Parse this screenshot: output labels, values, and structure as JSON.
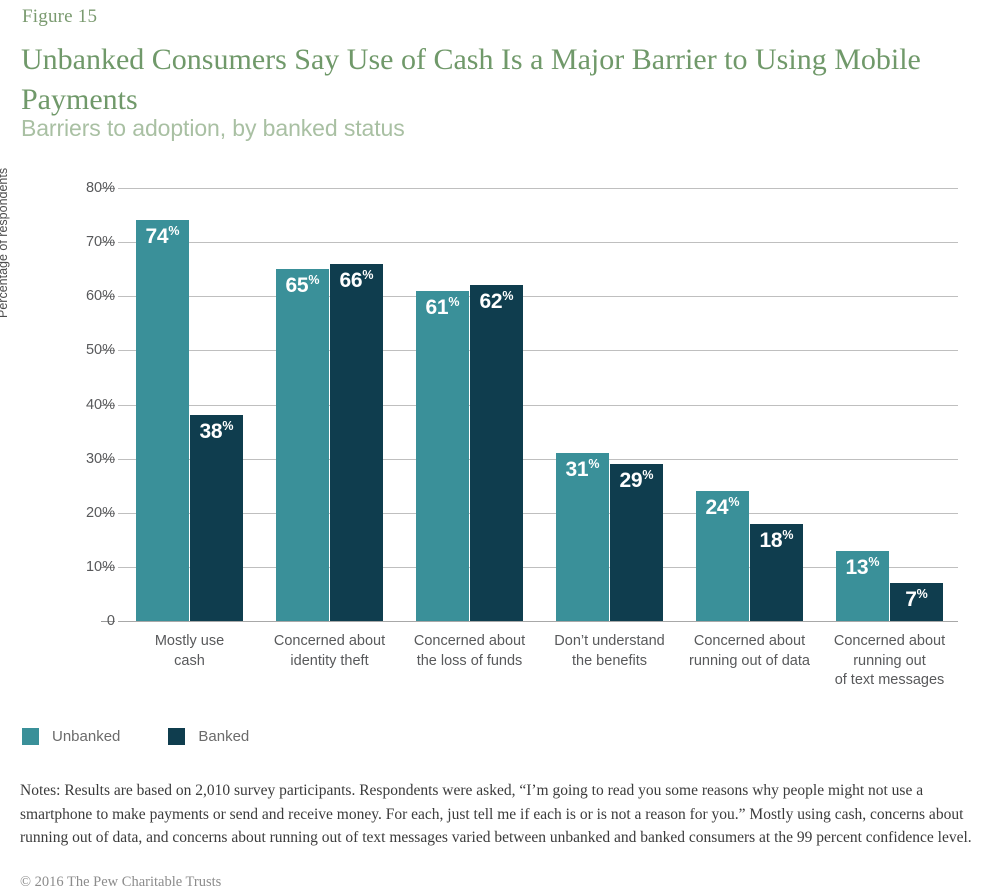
{
  "header": {
    "figure_label": "Figure 15",
    "title": "Unbanked Consumers Say Use of Cash Is a Major Barrier to Using Mobile Payments",
    "subtitle": "Barriers to adoption, by banked status"
  },
  "colors": {
    "unbanked": "#3a9099",
    "banked": "#0f3d4e",
    "title_green": "#70996a",
    "subtitle_green": "#a9c0a3",
    "gridline": "#bfbfbf"
  },
  "legend": {
    "items": [
      {
        "label": "Unbanked",
        "color": "#3a9099"
      },
      {
        "label": "Banked",
        "color": "#0f3d4e"
      }
    ]
  },
  "footer": {
    "notes": "Notes: Results are based on 2,010 survey participants. Respondents were asked, “I’m going to read you some reasons why people might not use a smartphone to make payments or send and receive money. For each, just tell me if each is or is not a reason for you.” Mostly using cash, concerns about running out of data, and concerns about running out of text messages varied between unbanked and banked consumers at the 99 percent confidence level.",
    "copyright": "© 2016 The Pew Charitable Trusts"
  },
  "chart_data": {
    "type": "bar",
    "title": "Unbanked Consumers Say Use of Cash Is a Major Barrier to Using Mobile Payments",
    "subtitle": "Barriers to adoption, by banked status",
    "xlabel": "",
    "ylabel": "Percentage of respondents",
    "ylim": [
      0,
      80
    ],
    "ytick_values": [
      0,
      10,
      20,
      30,
      40,
      50,
      60,
      70,
      80
    ],
    "ytick_labels": [
      "0",
      "10%",
      "20%",
      "30%",
      "40%",
      "50%",
      "60%",
      "70%",
      "80%"
    ],
    "grid": true,
    "legend_position": "bottom-left",
    "categories": [
      "Mostly use\ncash",
      "Concerned about\nidentity theft",
      "Concerned about\nthe loss of funds",
      "Don’t understand\nthe benefits",
      "Concerned about\nrunning out of data",
      "Concerned about\nrunning out\nof text messages"
    ],
    "series": [
      {
        "name": "Unbanked",
        "color": "#3a9099",
        "values": [
          74,
          65,
          61,
          31,
          24,
          13
        ],
        "labels": [
          "74%",
          "65%",
          "61%",
          "31%",
          "24%",
          "13%"
        ]
      },
      {
        "name": "Banked",
        "color": "#0f3d4e",
        "values": [
          38,
          66,
          62,
          29,
          18,
          7
        ],
        "labels": [
          "38%",
          "66%",
          "62%",
          "29%",
          "18%",
          "7%"
        ]
      }
    ]
  }
}
